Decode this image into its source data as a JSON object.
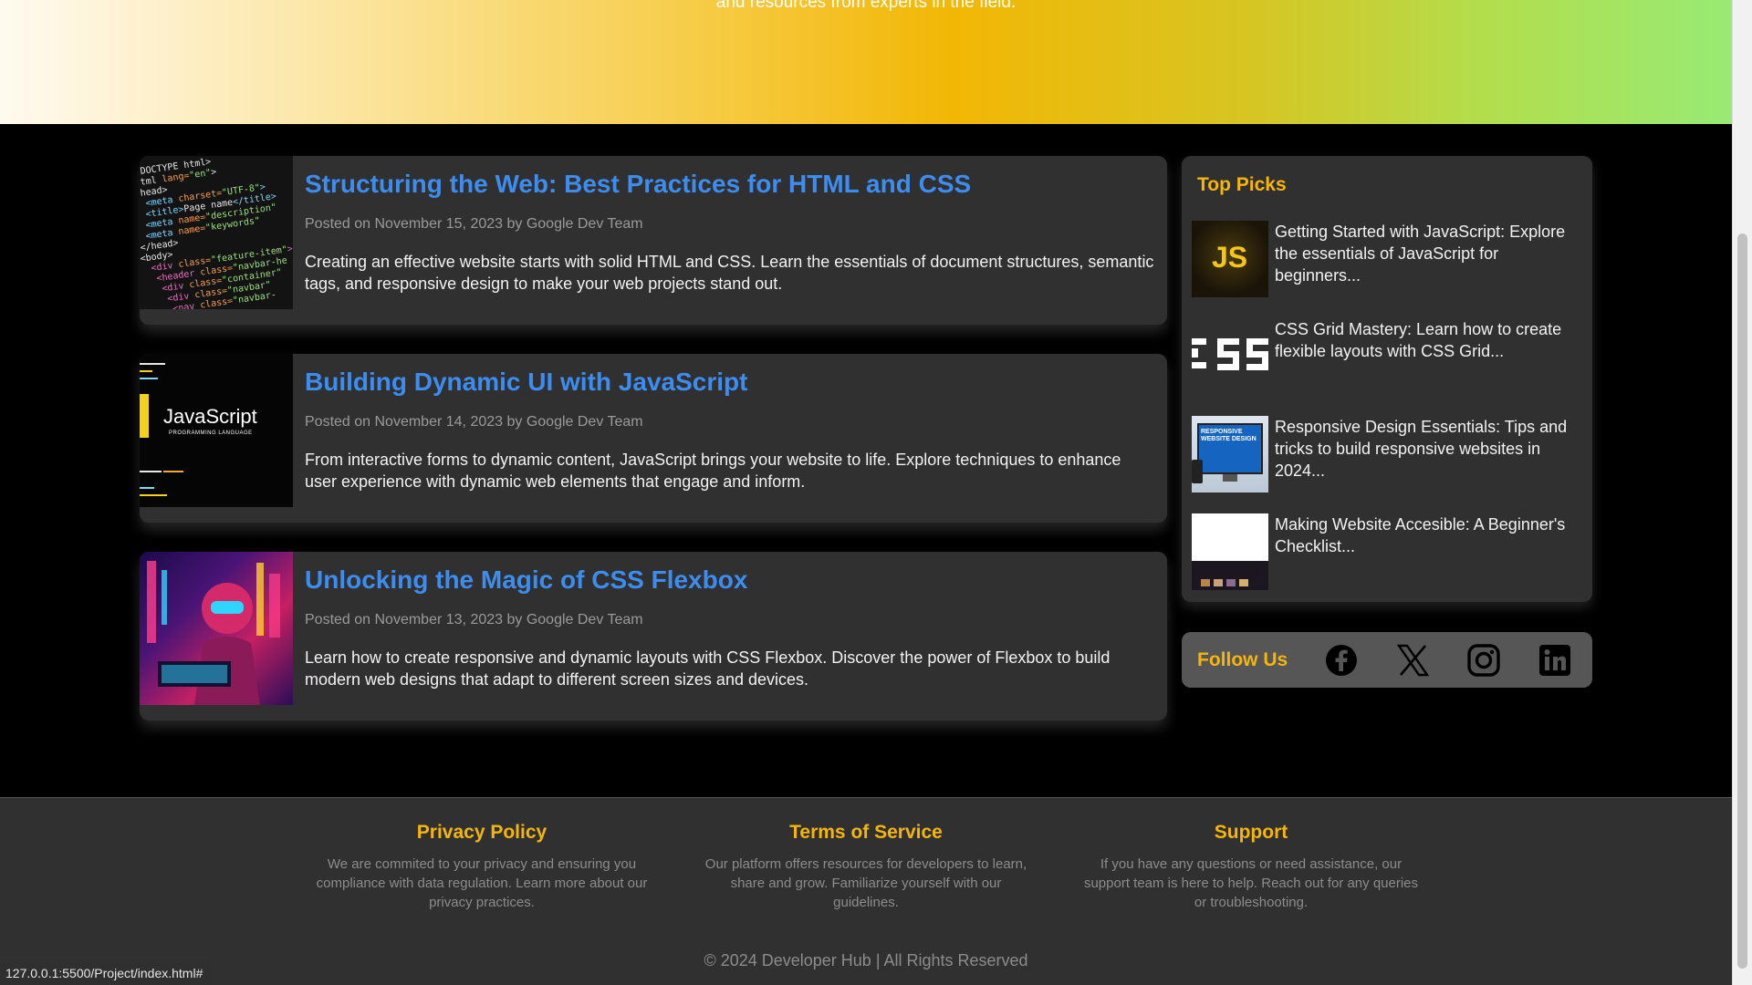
{
  "hero": {
    "subtitle": "and resources from experts in the field."
  },
  "posts": [
    {
      "title": "Structuring the Web: Best Practices for HTML and CSS",
      "meta": "Posted on November 15, 2023 by Google Dev Team",
      "excerpt": "Creating an effective website starts with solid HTML and CSS. Learn the essentials of document structures, semantic tags, and responsive design to make your web projects stand out.",
      "thumb_icon": "html-code-thumbnail"
    },
    {
      "title": "Building Dynamic UI with JavaScript",
      "meta": "Posted on November 14, 2023 by Google Dev Team",
      "excerpt": "From interactive forms to dynamic content, JavaScript brings your website to life. Explore techniques to enhance user experience with dynamic web elements that engage and inform.",
      "thumb_icon": "javascript-thumbnail",
      "thumb_text": "JavaScript",
      "thumb_subtext": "PROGRAMMING LANGUAGE"
    },
    {
      "title": "Unlocking the Magic of CSS Flexbox",
      "meta": "Posted on November 13, 2023 by Google Dev Team",
      "excerpt": "Learn how to create responsive and dynamic layouts with CSS Flexbox. Discover the power of Flexbox to build modern web designs that adapt to different screen sizes and devices.",
      "thumb_icon": "neon-robot-thumbnail"
    }
  ],
  "sidebar": {
    "top_picks_title": "Top Picks",
    "top_picks": [
      {
        "text": "Getting Started with JavaScript: Explore the essentials of JavaScript for beginners...",
        "thumb_icon": "js-logo-thumbnail",
        "thumb_text": "JS"
      },
      {
        "text": "CSS Grid Mastery: Learn how to create flexible layouts with CSS Grid...",
        "thumb_icon": "css-logo-thumbnail",
        "thumb_text": "CSS"
      },
      {
        "text": "Responsive Design Essentials: Tips and tricks to build responsive websites in 2024...",
        "thumb_icon": "responsive-design-thumbnail",
        "thumb_text": "RESPONSIVE WEBSITE DESIGN"
      },
      {
        "text": "Making Website Accesible: A Beginner's Checklist...",
        "thumb_icon": "website-screenshot-thumbnail"
      }
    ],
    "follow_label": "Follow Us",
    "social": [
      "facebook-icon",
      "x-twitter-icon",
      "instagram-icon",
      "linkedin-icon"
    ]
  },
  "footer": {
    "columns": [
      {
        "title": "Privacy Policy",
        "text": "We are commited to your privacy and ensuring you compliance with data regulation. Learn more about our privacy practices."
      },
      {
        "title": "Terms of Service",
        "text": "Our platform offers resources for developers to learn, share and grow. Familiarize yourself with our guidelines."
      },
      {
        "title": "Support",
        "text": "If you have any questions or need assistance, our support team is here to help. Reach out for any queries or troubleshooting."
      }
    ],
    "copyright": "© 2024 Developer Hub | All Rights Reserved"
  },
  "status_url": "127.0.0.1:5500/Project/index.html#",
  "colors": {
    "accent": "#f5b50a",
    "link": "#3d8df0",
    "card": "#303030",
    "background": "#000000"
  }
}
